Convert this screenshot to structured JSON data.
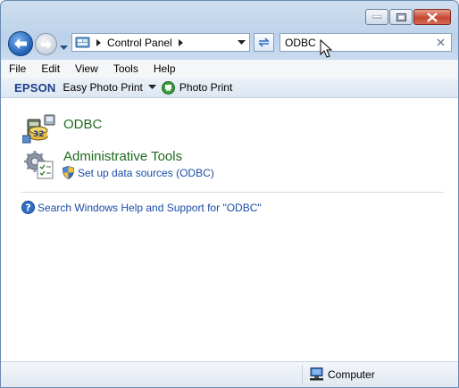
{
  "address": {
    "crumbs": [
      "Control Panel"
    ]
  },
  "search": {
    "query": "ODBC"
  },
  "menu": {
    "items": [
      "File",
      "Edit",
      "View",
      "Tools",
      "Help"
    ]
  },
  "toolbar": {
    "brand": "EPSON",
    "easy_photo_print": "Easy Photo Print",
    "photo_print": "Photo Print"
  },
  "results": {
    "items": [
      {
        "title": "ODBC",
        "icon": "odbc-icon",
        "tasks": []
      },
      {
        "title": "Administrative Tools",
        "icon": "admin-tools-icon",
        "tasks": [
          {
            "label": "Set up data sources (ODBC)",
            "icon": "uac-shield-icon"
          }
        ]
      }
    ],
    "help_link": "Search Windows Help and Support for \"ODBC\""
  },
  "status": {
    "location": "Computer"
  },
  "colors": {
    "green_link": "#1e6b1e",
    "blue_link": "#1a4ba8",
    "close_button": "#c74632"
  }
}
